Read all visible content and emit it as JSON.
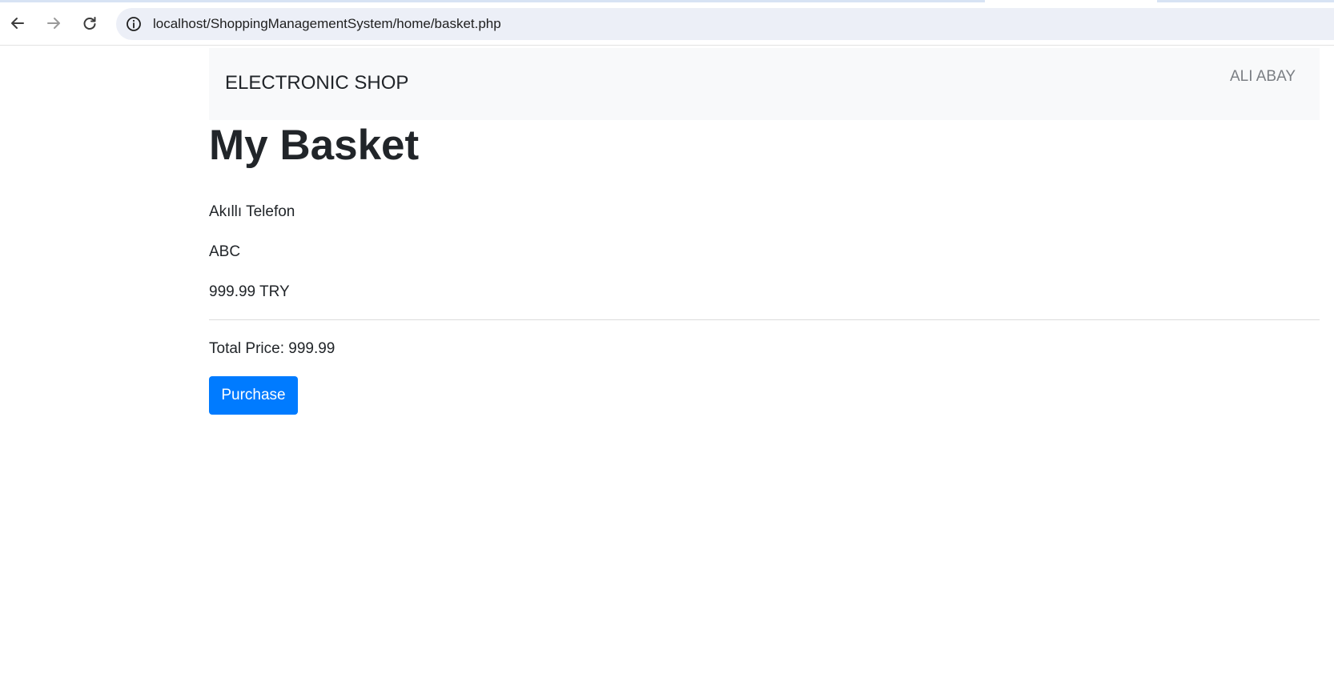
{
  "browser": {
    "url": "localhost/ShoppingManagementSystem/home/basket.php",
    "icons": {
      "back": "arrow-left-icon",
      "forward": "arrow-right-icon",
      "reload": "reload-icon",
      "site_info": "info-icon"
    }
  },
  "navbar": {
    "brand": "ELECTRONIC SHOP",
    "user": "ALI ABAY"
  },
  "main": {
    "title": "My Basket",
    "items": [
      {
        "name": "Akıllı Telefon",
        "brand": "ABC",
        "price": "999.99 TRY"
      }
    ],
    "total": "Total Price: 999.99",
    "purchase_label": "Purchase"
  },
  "colors": {
    "navbar_bg": "#f8f9fa",
    "button_primary": "#007bff",
    "omnibox_bg": "#eceff7",
    "text": "#212529",
    "muted_text": "#7b7f84"
  }
}
